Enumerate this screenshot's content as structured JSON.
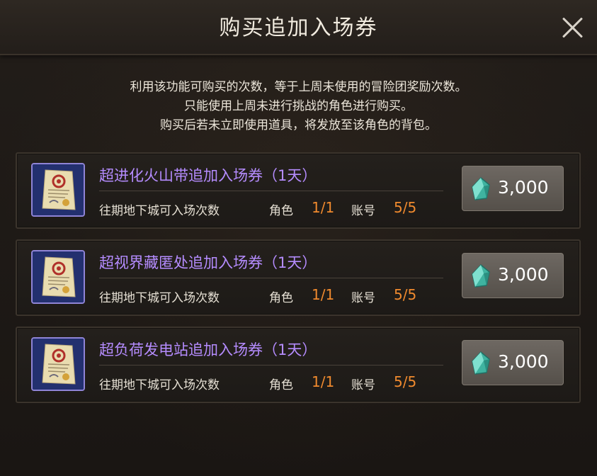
{
  "dialog": {
    "title": "购买追加入场券",
    "close_icon": "close-icon"
  },
  "description": [
    "利用该功能可购买的次数，等于上周未使用的冒险团奖励次数。",
    "只能使用上周未进行挑战的角色进行购买。",
    "购买后若未立即使用道具，将发放至该角色的背包。"
  ],
  "items": [
    {
      "name": "超进化火山带追加入场券（1天）",
      "stat_label": "往期地下城可入场次数",
      "role_label": "角色",
      "role_value": "1/1",
      "account_label": "账号",
      "account_value": "5/5",
      "price": "3,000",
      "icon": "ticket-scroll-icon",
      "currency_icon": "gem-icon"
    },
    {
      "name": "超视界藏匿处追加入场券（1天）",
      "stat_label": "往期地下城可入场次数",
      "role_label": "角色",
      "role_value": "1/1",
      "account_label": "账号",
      "account_value": "5/5",
      "price": "3,000",
      "icon": "ticket-scroll-icon",
      "currency_icon": "gem-icon"
    },
    {
      "name": "超负荷发电站追加入场券（1天）",
      "stat_label": "往期地下城可入场次数",
      "role_label": "角色",
      "role_value": "1/1",
      "account_label": "账号",
      "account_value": "5/5",
      "price": "3,000",
      "icon": "ticket-scroll-icon",
      "currency_icon": "gem-icon"
    }
  ],
  "colors": {
    "item_name": "#b58cff",
    "count_value": "#f08a2e",
    "background": "#1b1714"
  }
}
